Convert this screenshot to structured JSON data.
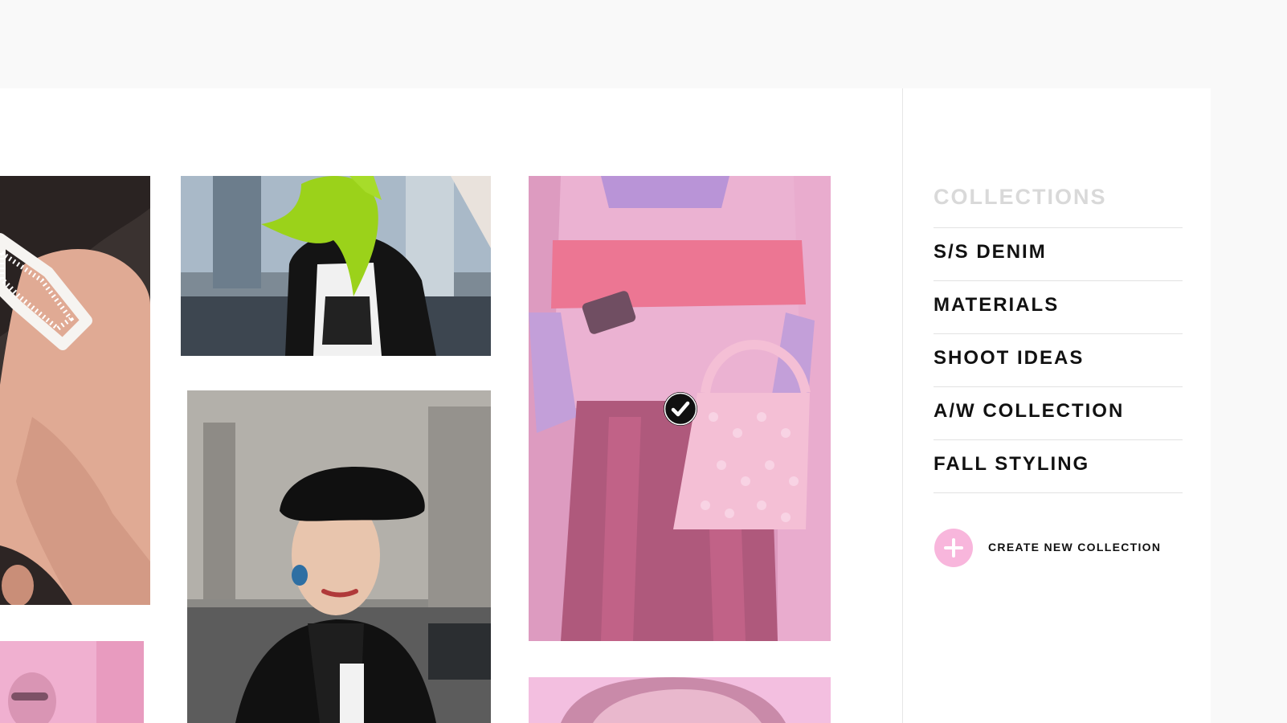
{
  "panel": {
    "title": "COLLECTIONS",
    "items": [
      {
        "label": "S/S DENIM"
      },
      {
        "label": "MATERIALS"
      },
      {
        "label": "SHOOT IDEAS"
      },
      {
        "label": "A/W COLLECTION"
      },
      {
        "label": "FALL STYLING"
      }
    ],
    "create_label": "CREATE NEW COLLECTION",
    "create_icon": "plus-icon"
  },
  "gallery": {
    "selected_tile": "pink-sweater-beaded-bag-photo",
    "selected_icon": "checkmark-icon"
  },
  "colors": {
    "page_bg": "#f9f9f9",
    "card_bg": "#ffffff",
    "accent_pink": "#f8b6dc",
    "selection_overlay": "#e7a2cc",
    "text_dark": "#111111",
    "text_muted": "#d9d9d9"
  }
}
